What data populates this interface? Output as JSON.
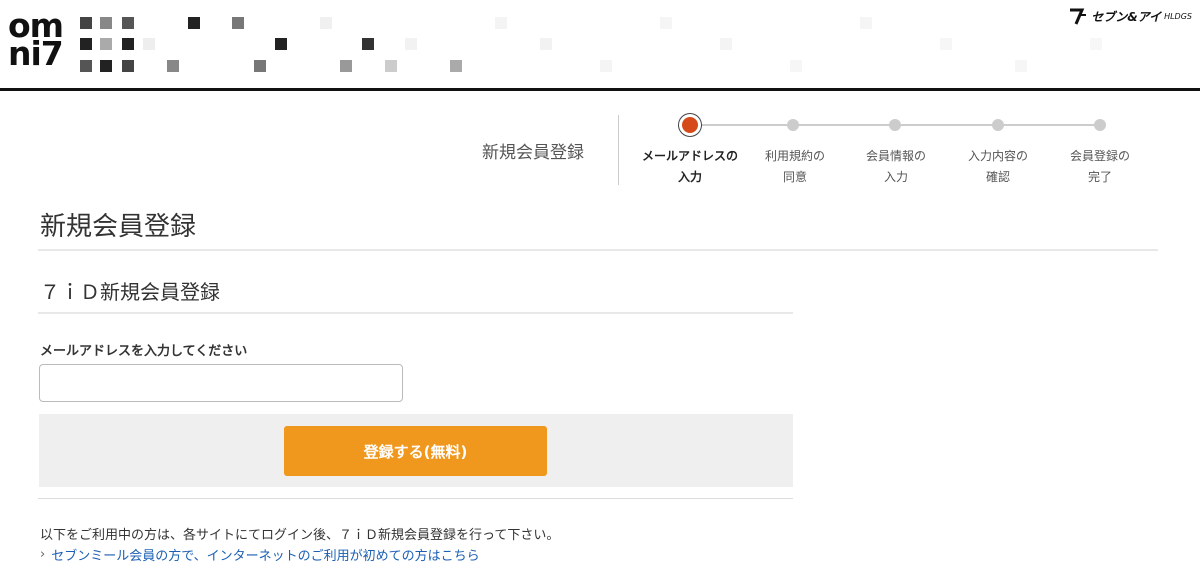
{
  "header": {
    "logo_line1": "om",
    "logo_line2": "ni7",
    "corp_name": "セブン&アイ",
    "corp_suffix": "HLDGS"
  },
  "stepper": {
    "title": "新規会員登録",
    "steps": [
      {
        "line1": "メールアドレスの",
        "line2": "入力",
        "active": true
      },
      {
        "line1": "利用規約の",
        "line2": "同意",
        "active": false
      },
      {
        "line1": "会員情報の",
        "line2": "入力",
        "active": false
      },
      {
        "line1": "入力内容の",
        "line2": "確認",
        "active": false
      },
      {
        "line1": "会員登録の",
        "line2": "完了",
        "active": false
      }
    ]
  },
  "main": {
    "page_title": "新規会員登録",
    "section_title": "７ｉＤ新規会員登録",
    "email_label": "メールアドレスを入力してください",
    "email_value": "",
    "register_button": "登録する(無料)",
    "note": "以下をご利用中の方は、各サイトにてログイン後、７ｉＤ新規会員登録を行って下さい。",
    "link_text": "セブンミール会員の方で、インターネットのご利用が初めての方はこちら"
  },
  "colors": {
    "accent_button": "#f0981d",
    "active_step": "#d64a1a",
    "link": "#1a5fb4"
  }
}
